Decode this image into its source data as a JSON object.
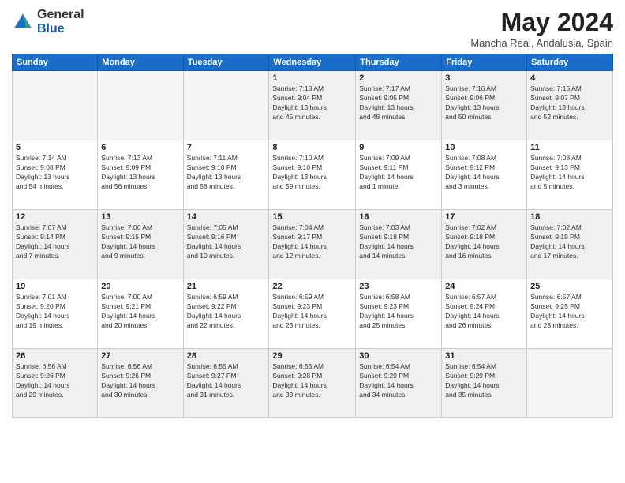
{
  "logo": {
    "general": "General",
    "blue": "Blue"
  },
  "title": "May 2024",
  "location": "Mancha Real, Andalusia, Spain",
  "days_of_week": [
    "Sunday",
    "Monday",
    "Tuesday",
    "Wednesday",
    "Thursday",
    "Friday",
    "Saturday"
  ],
  "weeks": [
    [
      {
        "day": "",
        "info": ""
      },
      {
        "day": "",
        "info": ""
      },
      {
        "day": "",
        "info": ""
      },
      {
        "day": "1",
        "info": "Sunrise: 7:18 AM\nSunset: 9:04 PM\nDaylight: 13 hours\nand 45 minutes."
      },
      {
        "day": "2",
        "info": "Sunrise: 7:17 AM\nSunset: 9:05 PM\nDaylight: 13 hours\nand 48 minutes."
      },
      {
        "day": "3",
        "info": "Sunrise: 7:16 AM\nSunset: 9:06 PM\nDaylight: 13 hours\nand 50 minutes."
      },
      {
        "day": "4",
        "info": "Sunrise: 7:15 AM\nSunset: 9:07 PM\nDaylight: 13 hours\nand 52 minutes."
      }
    ],
    [
      {
        "day": "5",
        "info": "Sunrise: 7:14 AM\nSunset: 9:08 PM\nDaylight: 13 hours\nand 54 minutes."
      },
      {
        "day": "6",
        "info": "Sunrise: 7:13 AM\nSunset: 9:09 PM\nDaylight: 13 hours\nand 56 minutes."
      },
      {
        "day": "7",
        "info": "Sunrise: 7:11 AM\nSunset: 9:10 PM\nDaylight: 13 hours\nand 58 minutes."
      },
      {
        "day": "8",
        "info": "Sunrise: 7:10 AM\nSunset: 9:10 PM\nDaylight: 13 hours\nand 59 minutes."
      },
      {
        "day": "9",
        "info": "Sunrise: 7:09 AM\nSunset: 9:11 PM\nDaylight: 14 hours\nand 1 minute."
      },
      {
        "day": "10",
        "info": "Sunrise: 7:08 AM\nSunset: 9:12 PM\nDaylight: 14 hours\nand 3 minutes."
      },
      {
        "day": "11",
        "info": "Sunrise: 7:08 AM\nSunset: 9:13 PM\nDaylight: 14 hours\nand 5 minutes."
      }
    ],
    [
      {
        "day": "12",
        "info": "Sunrise: 7:07 AM\nSunset: 9:14 PM\nDaylight: 14 hours\nand 7 minutes."
      },
      {
        "day": "13",
        "info": "Sunrise: 7:06 AM\nSunset: 9:15 PM\nDaylight: 14 hours\nand 9 minutes."
      },
      {
        "day": "14",
        "info": "Sunrise: 7:05 AM\nSunset: 9:16 PM\nDaylight: 14 hours\nand 10 minutes."
      },
      {
        "day": "15",
        "info": "Sunrise: 7:04 AM\nSunset: 9:17 PM\nDaylight: 14 hours\nand 12 minutes."
      },
      {
        "day": "16",
        "info": "Sunrise: 7:03 AM\nSunset: 9:18 PM\nDaylight: 14 hours\nand 14 minutes."
      },
      {
        "day": "17",
        "info": "Sunrise: 7:02 AM\nSunset: 9:18 PM\nDaylight: 14 hours\nand 16 minutes."
      },
      {
        "day": "18",
        "info": "Sunrise: 7:02 AM\nSunset: 9:19 PM\nDaylight: 14 hours\nand 17 minutes."
      }
    ],
    [
      {
        "day": "19",
        "info": "Sunrise: 7:01 AM\nSunset: 9:20 PM\nDaylight: 14 hours\nand 19 minutes."
      },
      {
        "day": "20",
        "info": "Sunrise: 7:00 AM\nSunset: 9:21 PM\nDaylight: 14 hours\nand 20 minutes."
      },
      {
        "day": "21",
        "info": "Sunrise: 6:59 AM\nSunset: 9:22 PM\nDaylight: 14 hours\nand 22 minutes."
      },
      {
        "day": "22",
        "info": "Sunrise: 6:59 AM\nSunset: 9:23 PM\nDaylight: 14 hours\nand 23 minutes."
      },
      {
        "day": "23",
        "info": "Sunrise: 6:58 AM\nSunset: 9:23 PM\nDaylight: 14 hours\nand 25 minutes."
      },
      {
        "day": "24",
        "info": "Sunrise: 6:57 AM\nSunset: 9:24 PM\nDaylight: 14 hours\nand 26 minutes."
      },
      {
        "day": "25",
        "info": "Sunrise: 6:57 AM\nSunset: 9:25 PM\nDaylight: 14 hours\nand 28 minutes."
      }
    ],
    [
      {
        "day": "26",
        "info": "Sunrise: 6:56 AM\nSunset: 9:26 PM\nDaylight: 14 hours\nand 29 minutes."
      },
      {
        "day": "27",
        "info": "Sunrise: 6:56 AM\nSunset: 9:26 PM\nDaylight: 14 hours\nand 30 minutes."
      },
      {
        "day": "28",
        "info": "Sunrise: 6:55 AM\nSunset: 9:27 PM\nDaylight: 14 hours\nand 31 minutes."
      },
      {
        "day": "29",
        "info": "Sunrise: 6:55 AM\nSunset: 9:28 PM\nDaylight: 14 hours\nand 33 minutes."
      },
      {
        "day": "30",
        "info": "Sunrise: 6:54 AM\nSunset: 9:29 PM\nDaylight: 14 hours\nand 34 minutes."
      },
      {
        "day": "31",
        "info": "Sunrise: 6:54 AM\nSunset: 9:29 PM\nDaylight: 14 hours\nand 35 minutes."
      },
      {
        "day": "",
        "info": ""
      }
    ]
  ]
}
